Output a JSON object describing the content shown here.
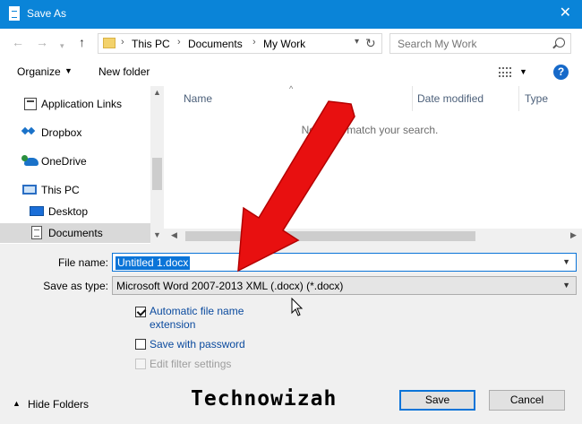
{
  "window": {
    "title": "Save As"
  },
  "address": {
    "crumbs": [
      "This PC",
      "Documents",
      "My Work"
    ]
  },
  "search": {
    "placeholder": "Search My Work"
  },
  "toolbar": {
    "organize_label": "Organize",
    "new_folder_label": "New folder"
  },
  "nav_pane": {
    "items": [
      {
        "label": "Application Links",
        "icon": "app-links-icon"
      },
      {
        "label": "Dropbox",
        "icon": "dropbox-icon"
      },
      {
        "label": "OneDrive",
        "icon": "onedrive-icon"
      },
      {
        "label": "This PC",
        "icon": "computer-icon"
      },
      {
        "label": "Desktop",
        "icon": "desktop-icon"
      },
      {
        "label": "Documents",
        "icon": "documents-icon",
        "selected": true
      }
    ]
  },
  "file_list": {
    "columns": [
      "Name",
      "Date modified",
      "Type"
    ],
    "empty_message": "No items match your search."
  },
  "form": {
    "file_name_label": "File name:",
    "file_name_value": "Untitled 1.docx",
    "save_type_label": "Save as type:",
    "save_type_value": "Microsoft Word 2007-2013 XML (.docx) (*.docx)",
    "checkboxes": [
      {
        "label_line1": "Automatic file name",
        "label_line2": "extension",
        "checked": true,
        "enabled": true
      },
      {
        "label": "Save with password",
        "checked": false,
        "enabled": true
      },
      {
        "label": "Edit filter settings",
        "checked": false,
        "enabled": false
      }
    ]
  },
  "footer": {
    "hide_folders_label": "Hide Folders",
    "save_label": "Save",
    "cancel_label": "Cancel",
    "watermark": "Technowizah"
  },
  "colors": {
    "accent": "#0a84d8",
    "arrow": "#e81010"
  }
}
